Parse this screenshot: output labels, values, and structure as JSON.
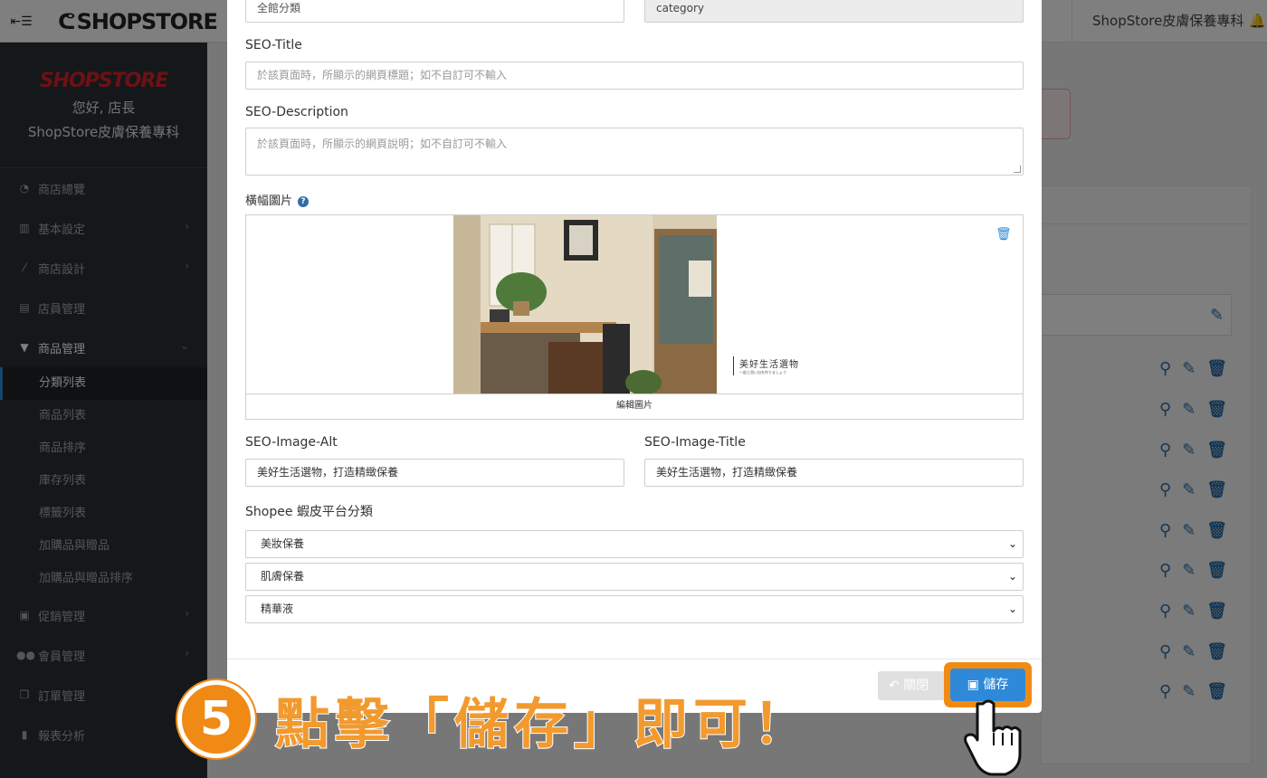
{
  "topbar": {
    "brand": "SHOPSTORE",
    "shop_name": "ShopStore皮膚保養專科"
  },
  "sidebar": {
    "logo": "SHOPSTORE",
    "greeting": "您好, 店長",
    "shop_name": "ShopStore皮膚保養專科",
    "items": [
      {
        "label": "商店總覽",
        "icon": "dashboard-icon"
      },
      {
        "label": "基本設定",
        "icon": "bank-icon"
      },
      {
        "label": "商店設計",
        "icon": "magic-wand-icon"
      },
      {
        "label": "店員管理",
        "icon": "lock-icon"
      },
      {
        "label": "商品管理",
        "icon": "cart-icon"
      },
      {
        "label": "促銷管理",
        "icon": "gift-icon"
      },
      {
        "label": "會員管理",
        "icon": "users-icon"
      },
      {
        "label": "訂單管理",
        "icon": "copy-icon"
      },
      {
        "label": "報表分析",
        "icon": "bar-chart-icon"
      }
    ],
    "sub_items": [
      "分類列表",
      "商品列表",
      "商品排序",
      "庫存列表",
      "標籤列表",
      "加購品與贈品",
      "加購品與贈品排序"
    ]
  },
  "modal": {
    "category_name_value": "全館分類",
    "category_slug_value": "category",
    "seo_title_label": "SEO-Title",
    "seo_title_placeholder": "於該頁面時，所顯示的網頁標題；如不自訂可不輸入",
    "seo_desc_label": "SEO-Description",
    "seo_desc_placeholder": "於該頁面時，所顯示的網頁說明；如不自訂可不輸入",
    "banner_label": "橫幅圖片",
    "banner_caption_main": "美好生活選物",
    "banner_caption_sub": "一起と思い出を作りましょう",
    "banner_edit_label": "編輯圖片",
    "img_alt_label": "SEO-Image-Alt",
    "img_alt_value": "美好生活選物，打造精緻保養",
    "img_title_label": "SEO-Image-Title",
    "img_title_value": "美好生活選物，打造精緻保養",
    "shopee_label": "Shopee 蝦皮平台分類",
    "shopee_selects": [
      "美妝保養",
      "肌膚保養",
      "精華液"
    ],
    "close_label": "關閉",
    "save_label": "儲存"
  },
  "callout": {
    "number": "5",
    "text": "點擊「儲存」即可！"
  },
  "colors": {
    "accent": "#2e8ad8",
    "highlight": "#f08a15",
    "sidebar": "#2b3035",
    "brand_red": "#d8232a"
  }
}
